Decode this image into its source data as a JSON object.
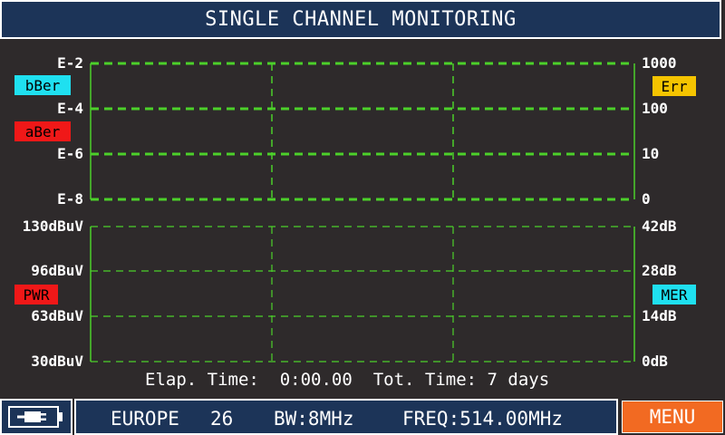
{
  "header": {
    "title": "SINGLE CHANNEL MONITORING"
  },
  "upper_chart": {
    "left_ticks": [
      "E-2",
      "E-4",
      "E-6",
      "E-8"
    ],
    "right_ticks": [
      "1000",
      "100",
      "10",
      "0"
    ],
    "badges": {
      "bber": {
        "label": "bBer",
        "color": "#1fe0f0"
      },
      "aber": {
        "label": "aBer",
        "color": "#f01818"
      },
      "err": {
        "label": "Err",
        "color": "#f5c400"
      }
    }
  },
  "lower_chart": {
    "left_ticks": [
      "130dBuV",
      "96dBuV",
      "63dBuV",
      "30dBuV"
    ],
    "right_ticks": [
      "42dB",
      "28dB",
      "14dB",
      "0dB"
    ],
    "badges": {
      "pwr": {
        "label": "PWR",
        "color": "#f01818"
      },
      "mer": {
        "label": "MER",
        "color": "#1fe0f0"
      }
    }
  },
  "status": {
    "elapsed_label": "Elap. Time:",
    "elapsed_value": "0:00.00",
    "total_label": "Tot. Time:",
    "total_value": "7 days"
  },
  "footer": {
    "battery_icon": "battery-plug-icon",
    "region": "EUROPE",
    "channel": "26",
    "bandwidth": "BW:8MHz",
    "frequency": "FREQ:514.00MHz",
    "menu_label": "MENU"
  },
  "colors": {
    "grid": "#4cd02a",
    "header_bg": "#1c3458",
    "background": "#2e2a2b",
    "menu_bg": "#f26a22"
  }
}
